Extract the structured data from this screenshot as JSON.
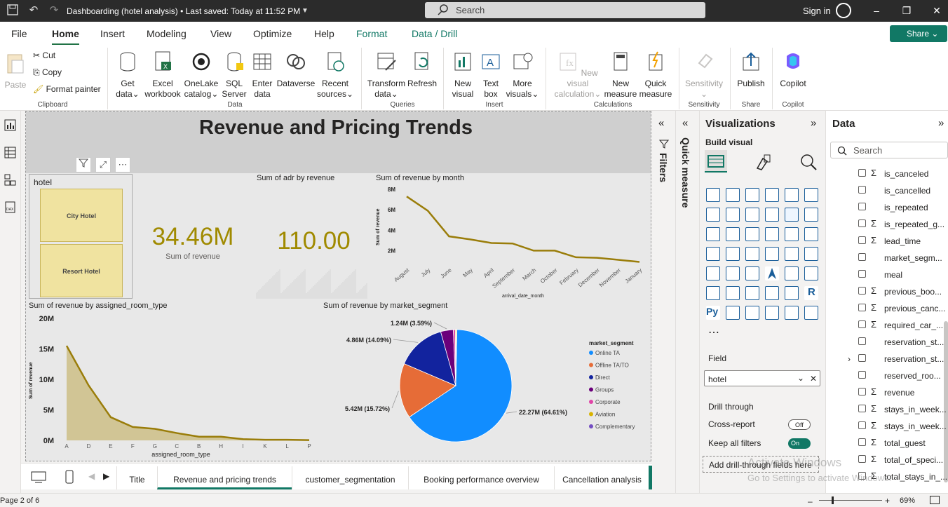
{
  "titlebar": {
    "title": "Dashboarding (hotel analysis) • Last saved: Today at 11:52 PM",
    "search_placeholder": "Search",
    "signin": "Sign in"
  },
  "menu": {
    "tabs": [
      "File",
      "Home",
      "Insert",
      "Modeling",
      "View",
      "Optimize",
      "Help",
      "Format",
      "Data / Drill"
    ],
    "active": "Home",
    "share": "Share"
  },
  "ribbon": {
    "clipboard": {
      "paste": "Paste",
      "cut": "Cut",
      "copy": "Copy",
      "format_painter": "Format painter",
      "group": "Clipboard"
    },
    "data": {
      "get_data": "Get data",
      "excel": "Excel workbook",
      "onelake": "OneLake catalog",
      "sql": "SQL Server",
      "enter": "Enter data",
      "dataverse": "Dataverse",
      "recent": "Recent sources",
      "group": "Data"
    },
    "queries": {
      "transform": "Transform data",
      "refresh": "Refresh",
      "group": "Queries"
    },
    "insert": {
      "new_visual": "New visual",
      "text_box": "Text box",
      "more_visuals": "More visuals",
      "group": "Insert"
    },
    "calculations": {
      "new_visual_calc": "New visual calculation",
      "new_measure": "New measure",
      "quick_measure": "Quick measure",
      "group": "Calculations"
    },
    "sensitivity": {
      "label": "Sensitivity",
      "group": "Sensitivity"
    },
    "share": {
      "publish": "Publish",
      "group": "Share"
    },
    "copilot": {
      "label": "Copilot",
      "group": "Copilot"
    }
  },
  "report": {
    "title": "Revenue and Pricing Trends",
    "slicer": {
      "title": "hotel",
      "items": [
        "City Hotel",
        "Resort Hotel"
      ]
    },
    "kpi_revenue": {
      "value": "34.46M",
      "label": "Sum of revenue"
    },
    "kpi_adr": {
      "title": "Sum of adr by revenue",
      "value": "110.00"
    },
    "line_title": "Sum of revenue by month",
    "area_title": "Sum of revenue by assigned_room_type",
    "pie_title": "Sum of revenue by market_segment"
  },
  "chart_data": [
    {
      "type": "line",
      "title": "Sum of revenue by month",
      "xlabel": "arrival_date_month",
      "ylabel": "Sum of revenue",
      "categories": [
        "August",
        "July",
        "June",
        "May",
        "April",
        "September",
        "March",
        "October",
        "February",
        "December",
        "November",
        "January"
      ],
      "yticks": [
        "2M",
        "4M",
        "6M",
        "8M"
      ],
      "ylim": [
        1000000,
        8000000
      ],
      "values": [
        7300000,
        5900000,
        3400000,
        3100000,
        2750000,
        2700000,
        2000000,
        2000000,
        1350000,
        1300000,
        1100000,
        900000
      ],
      "color": "#9a7d0a"
    },
    {
      "type": "area",
      "title": "Sum of revenue by assigned_room_type",
      "xlabel": "assigned_room_type",
      "ylabel": "Sum of revenue",
      "categories": [
        "A",
        "D",
        "E",
        "F",
        "G",
        "C",
        "B",
        "H",
        "I",
        "K",
        "L",
        "P"
      ],
      "yticks": [
        "0M",
        "5M",
        "10M",
        "15M",
        "20M"
      ],
      "ylim": [
        0,
        20000000
      ],
      "values": [
        15500000,
        9000000,
        3800000,
        2200000,
        1900000,
        1200000,
        600000,
        600000,
        200000,
        100000,
        100000,
        50000
      ],
      "color": "#9a7d0a"
    },
    {
      "type": "pie",
      "title": "Sum of revenue by market_segment",
      "legend_title": "market_segment",
      "slices": [
        {
          "name": "Online TA",
          "value": 22.27,
          "label": "22.27M (64.61%)",
          "color": "#118dff"
        },
        {
          "name": "Offline TA/TO",
          "value": 5.42,
          "label": "5.42M (15.72%)",
          "color": "#e66c37"
        },
        {
          "name": "Direct",
          "value": 4.86,
          "label": "4.86M (14.09%)",
          "color": "#12239e"
        },
        {
          "name": "Groups",
          "value": 1.24,
          "label": "1.24M (3.59%)",
          "color": "#6b007b"
        },
        {
          "name": "Corporate",
          "value": 0.2,
          "label": "",
          "color": "#e044a7"
        },
        {
          "name": "Aviation",
          "value": 0.1,
          "label": "",
          "color": "#d9b300"
        },
        {
          "name": "Complementary",
          "value": 0.05,
          "label": "",
          "color": "#744ec2"
        }
      ]
    }
  ],
  "pages": {
    "tabs": [
      "Title",
      "Revenue and pricing trends",
      "customer_segmentation",
      "Booking performance overview",
      "Cancellation analysis"
    ],
    "active": "Revenue and pricing trends"
  },
  "status": {
    "page": "Page 2 of 6",
    "zoom": "69%"
  },
  "panes": {
    "filters": "Filters",
    "quick_measure": "Quick measure",
    "visualizations": "Visualizations",
    "build_visual": "Build visual",
    "field_label": "Field",
    "field_value": "hotel",
    "drill_through": "Drill through",
    "cross_report": "Cross-report",
    "cross_report_state": "Off",
    "keep_all_filters": "Keep all filters",
    "keep_all_state": "On",
    "add_drill": "Add drill-through fields here"
  },
  "data_pane": {
    "title": "Data",
    "search_placeholder": "Search",
    "fields": [
      {
        "name": "is_canceled",
        "sigma": true
      },
      {
        "name": "is_cancelled",
        "sigma": false
      },
      {
        "name": "is_repeated",
        "sigma": false
      },
      {
        "name": "is_repeated_g...",
        "sigma": true
      },
      {
        "name": "lead_time",
        "sigma": true
      },
      {
        "name": "market_segm...",
        "sigma": false
      },
      {
        "name": "meal",
        "sigma": false
      },
      {
        "name": "previous_boo...",
        "sigma": true
      },
      {
        "name": "previous_canc...",
        "sigma": true
      },
      {
        "name": "required_car_...",
        "sigma": true
      },
      {
        "name": "reservation_st...",
        "sigma": false
      },
      {
        "name": "reservation_st...",
        "sigma": false
      },
      {
        "name": "reserved_roo...",
        "sigma": false
      },
      {
        "name": "revenue",
        "sigma": true
      },
      {
        "name": "stays_in_week...",
        "sigma": true
      },
      {
        "name": "stays_in_week...",
        "sigma": true
      },
      {
        "name": "total_guest",
        "sigma": true
      },
      {
        "name": "total_of_speci...",
        "sigma": true
      },
      {
        "name": "total_stays_in_...",
        "sigma": true
      }
    ]
  },
  "watermark": {
    "line1": "Activate Windows",
    "line2": "Go to Settings to activate Windows."
  }
}
